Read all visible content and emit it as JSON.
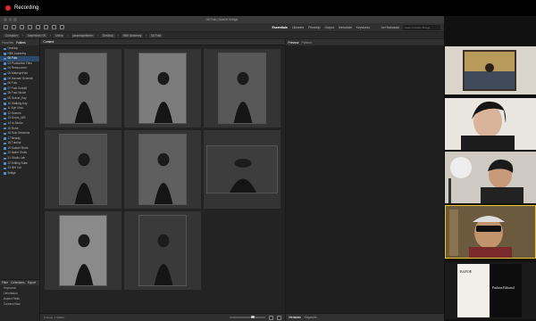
{
  "recording": {
    "label": "Recording"
  },
  "window": {
    "title": "06 Foto | Adobe Bridge"
  },
  "toolbar": {
    "workspaces": [
      "Essentials",
      "Libraries",
      "Filmstrip",
      "Output",
      "Metadata",
      "Keywords"
    ],
    "active_workspace": "Essentials",
    "user": "Juri Nakasaki",
    "search_placeholder": "Search Adobe Bridge"
  },
  "path": {
    "crumbs": [
      "Computer",
      "Macintosh HD",
      "Users",
      "jazzmagnifitrem",
      "Desktop",
      "HBK Academy",
      "06 Foto"
    ]
  },
  "left_panel": {
    "tabs": [
      "Favorites",
      "Folders"
    ],
    "active_tab": "Folders",
    "folders": [
      "Desktop",
      "HBK Academy",
      "06 Foto",
      "03 Production Files",
      "04 Ressourcen",
      "05 Makeup/Hair",
      "06 Hannah Schmidt",
      "06 Foto",
      "07 Foto Schnitt",
      "08 Foto Nicole",
      "09 Gravel_Kay",
      "10 Stalking Kay",
      "11 Eye Vinci",
      "12 Scenes",
      "13 Doors_N/S",
      "14 In Studio",
      "15 Ruhe",
      "16 Solo Sessions",
      "17 Beauty",
      "18 Tutorial",
      "19 Kassel Shots",
      "20 Ballet Shots",
      "21 Studio Lab",
      "22 Editing Suite",
      "23 NIK Cut",
      "Bridge"
    ],
    "selected_index": 2,
    "filter_tabs": [
      "Filter",
      "Collections",
      "Export"
    ],
    "filter_items": [
      "Keywords",
      "Orientation",
      "Aspect Ratio",
      "Camera Raw"
    ]
  },
  "content": {
    "tab": "Content",
    "thumbs": [
      {
        "name": "thumb-portrait-1",
        "tone": "#6b6b6b"
      },
      {
        "name": "thumb-portrait-2",
        "tone": "#7c7c7c"
      },
      {
        "name": "thumb-portrait-3",
        "tone": "#585858"
      },
      {
        "name": "thumb-portrait-4",
        "tone": "#4e4e4e"
      },
      {
        "name": "thumb-portrait-5",
        "tone": "#5f5f5f"
      },
      {
        "name": "thumb-landscape-6",
        "tone": "#3d3d3d"
      },
      {
        "name": "thumb-portrait-7",
        "tone": "#8a8a8a"
      },
      {
        "name": "thumb-portrait-8",
        "tone": "#3a3a3a"
      }
    ],
    "footer_count": "8 items, 1 hidden"
  },
  "right_panel": {
    "tabs": [
      "Preview",
      "Publish"
    ],
    "active_tab": "Preview",
    "meta_tabs": [
      "Metadata",
      "Keywords"
    ],
    "active_meta": "Metadata"
  },
  "video": {
    "slide": {
      "title": "Fashion Editorial",
      "brand": "BAFOE"
    }
  }
}
